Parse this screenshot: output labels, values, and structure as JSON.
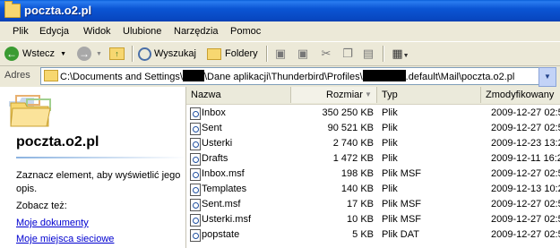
{
  "window": {
    "title": "poczta.o2.pl"
  },
  "menu": [
    "Plik",
    "Edycja",
    "Widok",
    "Ulubione",
    "Narzędzia",
    "Pomoc"
  ],
  "toolbar": {
    "back_label": "Wstecz",
    "search_label": "Wyszukaj",
    "folders_label": "Foldery"
  },
  "address": {
    "label": "Adres",
    "path_part1": "C:\\Documents and Settings\\",
    "path_part2": "\\Dane aplikacji\\Thunderbird\\Profiles\\",
    "path_part3": ".default\\Mail\\poczta.o2.pl"
  },
  "left_pane": {
    "title": "poczta.o2.pl",
    "description": "Zaznacz element, aby wyświetlić jego opis.",
    "see_also": "Zobacz też:",
    "links": [
      "Moje dokumenty",
      "Moje miejsca sieciowe"
    ]
  },
  "list": {
    "columns": {
      "name": "Nazwa",
      "size": "Rozmiar",
      "type": "Typ",
      "modified": "Zmodyfikowany"
    },
    "rows": [
      {
        "name": "Inbox",
        "size": "350 250 KB",
        "type": "Plik",
        "modified": "2009-12-27 02:5"
      },
      {
        "name": "Sent",
        "size": "90 521 KB",
        "type": "Plik",
        "modified": "2009-12-27 02:5"
      },
      {
        "name": "Usterki",
        "size": "2 740 KB",
        "type": "Plik",
        "modified": "2009-12-23 13:2"
      },
      {
        "name": "Drafts",
        "size": "1 472 KB",
        "type": "Plik",
        "modified": "2009-12-11 16:2"
      },
      {
        "name": "Inbox.msf",
        "size": "198 KB",
        "type": "Plik MSF",
        "modified": "2009-12-27 02:5"
      },
      {
        "name": "Templates",
        "size": "140 KB",
        "type": "Plik",
        "modified": "2009-12-13 10:2"
      },
      {
        "name": "Sent.msf",
        "size": "17 KB",
        "type": "Plik MSF",
        "modified": "2009-12-27 02:5"
      },
      {
        "name": "Usterki.msf",
        "size": "10 KB",
        "type": "Plik MSF",
        "modified": "2009-12-27 02:5"
      },
      {
        "name": "popstate",
        "size": "5 KB",
        "type": "Plik DAT",
        "modified": "2009-12-27 02:5"
      }
    ]
  }
}
